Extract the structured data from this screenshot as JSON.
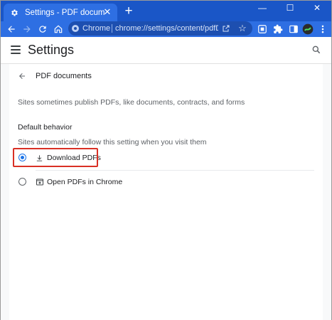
{
  "browser": {
    "tab": {
      "title": "Settings - PDF documents",
      "favicon": "gear-icon"
    },
    "new_tab_symbol": "+",
    "window_controls": {
      "minimize": "—",
      "maximize": "☐",
      "close": "✕"
    },
    "omnibox": {
      "chip_label": "Chrome",
      "url": "chrome://settings/content/pdfDo..."
    }
  },
  "settings": {
    "title": "Settings",
    "page": {
      "title": "PDF documents",
      "description": "Sites sometimes publish PDFs, like documents, contracts, and forms",
      "section_title": "Default behavior",
      "section_subtitle": "Sites automatically follow this setting when you visit them",
      "options": [
        {
          "label": "Download PDFs",
          "icon": "download-icon",
          "selected": true
        },
        {
          "label": "Open PDFs in Chrome",
          "icon": "open-in-browser-icon",
          "selected": false
        }
      ]
    }
  },
  "colors": {
    "tabstrip": "#1a56c7",
    "toolbar": "#2e6fe3",
    "accent": "#1a73e8",
    "highlight": "#d93025"
  }
}
